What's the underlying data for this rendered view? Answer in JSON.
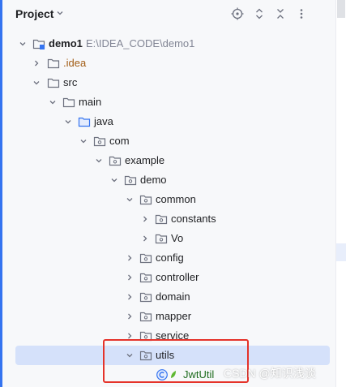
{
  "header": {
    "title": "Project",
    "icons": [
      "locate-icon",
      "expand-collapse-icon",
      "collapse-all-icon",
      "more-options-icon"
    ]
  },
  "tree": {
    "root": {
      "label": "demo1",
      "path": "E:\\IDEA_CODE\\demo1"
    },
    "idea": ".idea",
    "src": "src",
    "main": "main",
    "java": "java",
    "com": "com",
    "example": "example",
    "demo": "demo",
    "common": "common",
    "constants": "constants",
    "vo": "Vo",
    "config": "config",
    "controller": "controller",
    "domain": "domain",
    "mapper": "mapper",
    "service": "service",
    "utils": "utils",
    "jwtutil": "JwtUtil"
  },
  "selected_item": "utils",
  "watermark": "CSDN @知识浅谈",
  "colors": {
    "accent": "#3574f0",
    "selection": "#d5e1fa",
    "highlight_box": "#e5332a",
    "class_icon": "#3574f0",
    "idea_folder_text": "#a15c14"
  }
}
